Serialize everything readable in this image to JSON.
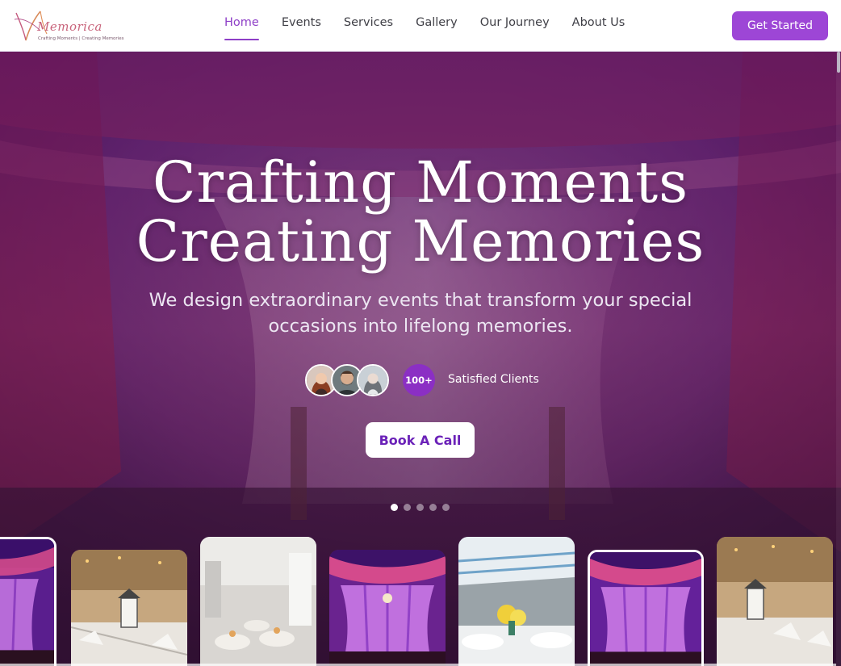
{
  "brand": {
    "name": "Memorica",
    "tagline": "Crafting Moments | Creating Memories",
    "colors": {
      "primary": "#9d46d6",
      "accent": "#8b2fc4",
      "nav_active": "#8e3fc7"
    }
  },
  "nav": {
    "items": [
      {
        "label": "Home",
        "active": true
      },
      {
        "label": "Events",
        "active": false
      },
      {
        "label": "Services",
        "active": false
      },
      {
        "label": "Gallery",
        "active": false
      },
      {
        "label": "Our Journey",
        "active": false
      },
      {
        "label": "About Us",
        "active": false
      }
    ],
    "cta_label": "Get Started"
  },
  "hero": {
    "headline_line1": "Crafting Moments",
    "headline_line2": "Creating Memories",
    "subtitle_line1": "We design extraordinary events that transform your special",
    "subtitle_line2": "occasions into lifelong memories.",
    "clients_count": "100+",
    "clients_label": "Satisfied Clients",
    "avatars": [
      "woman-avatar",
      "bearded-man-avatar",
      "woman-avatar-2"
    ],
    "button_label": "Book A Call",
    "slides_total": 5,
    "active_slide": 1
  },
  "thumbnails": [
    {
      "scene": "purple-curtain-stage",
      "selected": true
    },
    {
      "scene": "banquet-table-lantern",
      "selected": false
    },
    {
      "scene": "white-hall-round-tables",
      "selected": false
    },
    {
      "scene": "purple-curtain-stage",
      "selected": false
    },
    {
      "scene": "tent-flowers-tables",
      "selected": false
    },
    {
      "scene": "purple-curtain-stage",
      "selected": true
    },
    {
      "scene": "banquet-table-lantern",
      "selected": false
    }
  ]
}
